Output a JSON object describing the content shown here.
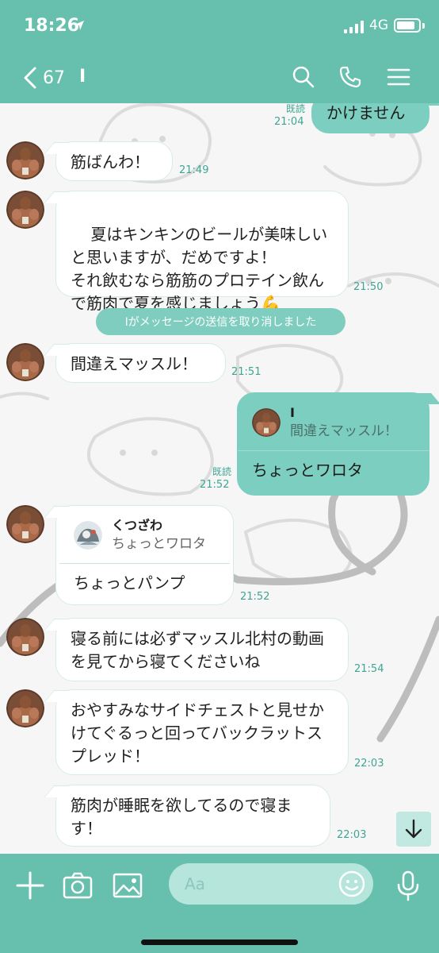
{
  "status_bar": {
    "time": "18:26",
    "network": "4G"
  },
  "header": {
    "back_count": "67",
    "chat_title": "I"
  },
  "messages": {
    "m0": {
      "text": "かけません",
      "read": "既読",
      "time": "21:04"
    },
    "m1": {
      "text": "筋ばんわ！",
      "time": "21:49"
    },
    "m2": {
      "text": "夏はキンキンのビールが美味しいと思いますが、だめですよ！\nそれ飲むなら筋筋のプロテイン飲んで筋肉で夏を感じましょう💪",
      "time": "21:50"
    },
    "system": "Iがメッセージの送信を取り消しました",
    "m3": {
      "text": "間違えマッスル！",
      "time": "21:51"
    },
    "m4": {
      "reply_name": "I",
      "reply_text": "間違えマッスル！",
      "text": "ちょっとワロタ",
      "read": "既読",
      "time": "21:52"
    },
    "m5": {
      "reply_name": "くつざわ",
      "reply_text": "ちょっとワロタ",
      "text": "ちょっとパンプ",
      "time": "21:52"
    },
    "m6": {
      "text": "寝る前には必ずマッスル北村の動画を見てから寝てくださいね",
      "time": "21:54"
    },
    "m7": {
      "text": "おやすみなサイドチェストと見せかけてぐるっと回ってバックラットスプレッド！",
      "time": "22:03"
    },
    "m8": {
      "text": "筋肉が睡眠を欲してるので寝ます！",
      "time": "22:03"
    }
  },
  "input": {
    "placeholder": "Aa"
  },
  "icons": [
    "location-arrow-icon",
    "signal-icon",
    "battery-icon",
    "back-chevron-icon",
    "search-icon",
    "phone-icon",
    "menu-icon",
    "arrow-down-icon",
    "plus-icon",
    "camera-icon",
    "image-icon",
    "emoji-icon",
    "microphone-icon"
  ],
  "colors": {
    "theme": "#67bfae",
    "outgoing_bubble": "#7ccfc0",
    "timestamp": "#3fa593",
    "system_pill": "#7fcdbf"
  }
}
